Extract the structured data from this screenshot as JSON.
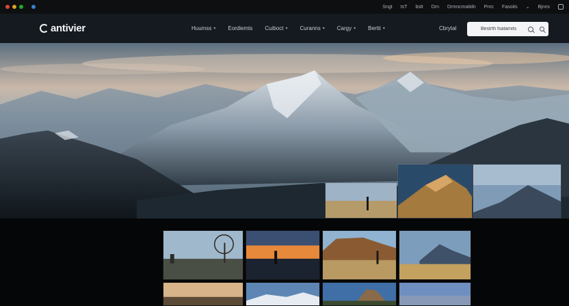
{
  "system_bar": {
    "items": [
      "Sngt",
      "tsT",
      "bstt",
      "Drn",
      "Drmncmatidn",
      "Pnrc",
      "Fasoits"
    ],
    "chevron": "chevron-down-icon",
    "menu_label": "Bjnns"
  },
  "header": {
    "logo_text": "antivier",
    "nav": [
      {
        "label": "Huumss",
        "has_menu": true
      },
      {
        "label": "Eordiemts",
        "has_menu": false
      },
      {
        "label": "Cuiboct",
        "has_menu": true
      },
      {
        "label": "Curanns",
        "has_menu": true
      },
      {
        "label": "Cargy",
        "has_menu": true
      },
      {
        "label": "Bertti",
        "has_menu": true
      }
    ],
    "contact_label": "Cbrytal",
    "search": {
      "value": "Bestrth fsatamits",
      "placeholder": ""
    }
  },
  "colors": {
    "nav_bg": "#141a1f",
    "page_bg": "#050607",
    "sysbar_bg": "#0d0f11"
  }
}
